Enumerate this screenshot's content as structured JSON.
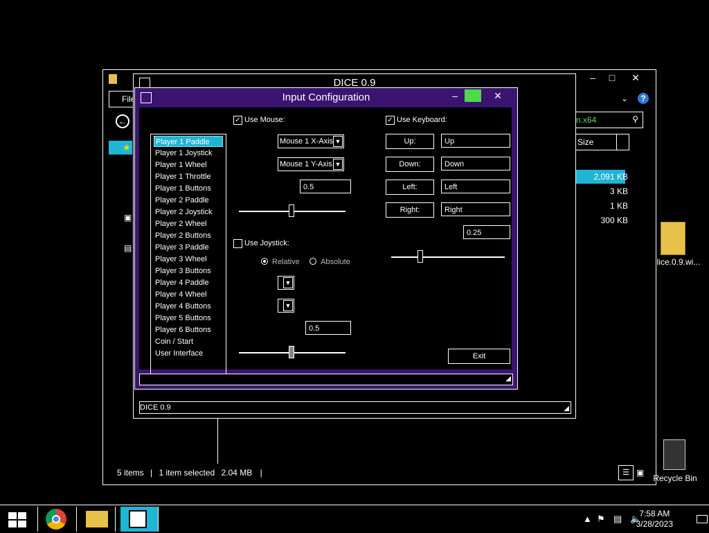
{
  "explorer": {
    "file_menu": "File",
    "search_text": "n.x64",
    "size_header": "Size",
    "sizes": [
      "2,091 KB",
      "3 KB",
      "1 KB",
      "300 KB"
    ],
    "status": {
      "items": "5 items",
      "selected": "1 item selected",
      "size": "2.04 MB"
    },
    "help": "?"
  },
  "dice_window": {
    "title": "DICE 0.9",
    "status": "DICE 0.9"
  },
  "dialog": {
    "title": "Input Configuration",
    "players": [
      "Player 1 Paddle",
      "Player 1 Joystick",
      "Player 1 Wheel",
      "Player 1 Throttle",
      "Player 1 Buttons",
      "Player 2 Paddle",
      "Player 2 Joystick",
      "Player 2 Wheel",
      "Player 2 Buttons",
      "Player 3 Paddle",
      "Player 3 Wheel",
      "Player 3 Buttons",
      "Player 4 Paddle",
      "Player 4 Wheel",
      "Player 4 Buttons",
      "Player 5 Buttons",
      "Player 6 Buttons",
      "Coin / Start",
      "User Interface"
    ],
    "mouse": {
      "label": "Use Mouse:",
      "checked": true,
      "x_axis": "Mouse 1 X-Axis",
      "y_axis": "Mouse 1 Y-Axis",
      "sensitivity": "0.5"
    },
    "joystick": {
      "label": "Use Joystick:",
      "checked": false,
      "relative": "Relative",
      "absolute": "Absolute",
      "sensitivity": "0.5"
    },
    "keyboard": {
      "label": "Use Keyboard:",
      "checked": true,
      "up_button": "Up:",
      "up_value": "Up",
      "down_button": "Down:",
      "down_value": "Down",
      "left_button": "Left:",
      "left_value": "Left",
      "right_button": "Right:",
      "right_value": "Right",
      "sensitivity": "0.25"
    },
    "exit": "Exit"
  },
  "desktop": {
    "folder_label": "lice.0.9.wi...",
    "recycle_label": "Recycle Bin"
  },
  "taskbar": {
    "time": "7:58 AM",
    "date": "3/28/2023"
  },
  "colors": {
    "dialog_frame": "#3a1470",
    "selection": "#1fb5d4",
    "maximize": "#4cd94c"
  }
}
